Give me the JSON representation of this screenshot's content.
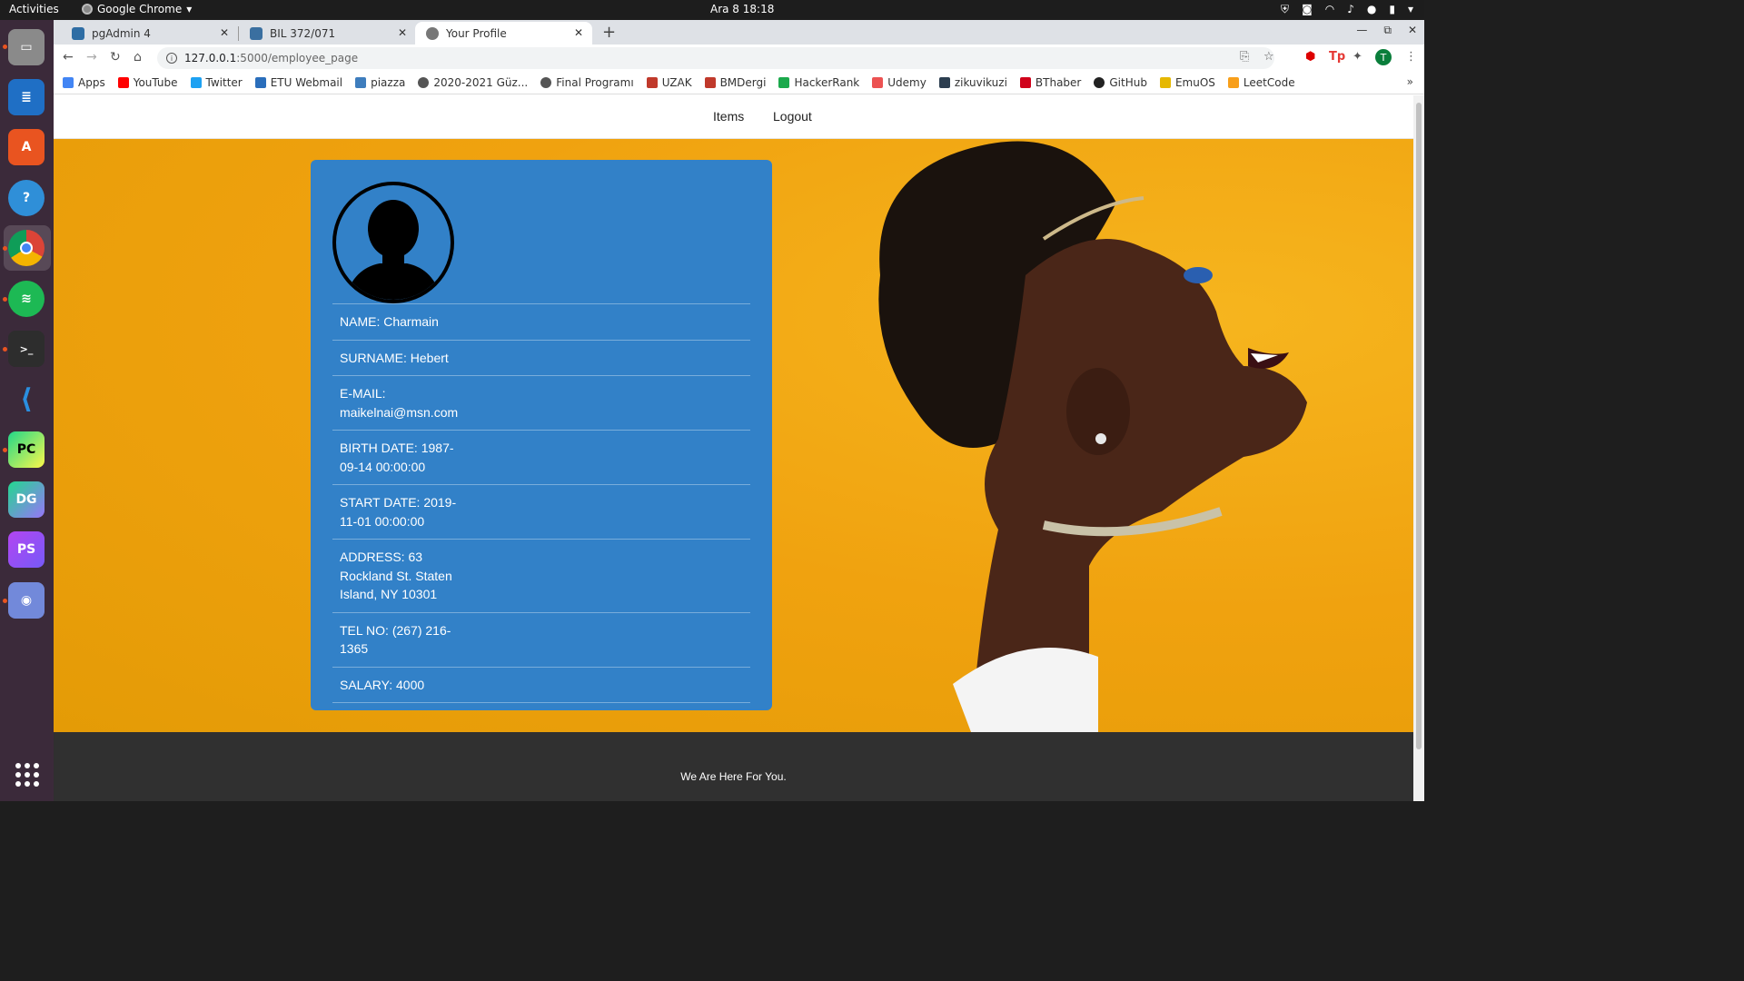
{
  "os": {
    "activities": "Activities",
    "app_name": "Google Chrome",
    "clock": "Ara 8  18:18"
  },
  "browser": {
    "tabs": [
      {
        "label": "pgAdmin 4",
        "active": false,
        "favicon_color": "#2e6da4"
      },
      {
        "label": "BIL 372/071",
        "active": false,
        "favicon_color": "#3a6fa0"
      },
      {
        "label": "Your Profile",
        "active": true,
        "favicon_color": "#777777"
      }
    ],
    "url_host": "127.0.0.1",
    "url_path": ":5000/employee_page",
    "profile_initial": "T",
    "bookmarks": [
      {
        "label": "Apps",
        "icon": "apps-grid-icon",
        "color": "#4285f4"
      },
      {
        "label": "YouTube",
        "icon": "youtube-icon",
        "color": "#ff0000"
      },
      {
        "label": "Twitter",
        "icon": "twitter-icon",
        "color": "#1da1f2"
      },
      {
        "label": "ETU Webmail",
        "icon": "webmail-icon",
        "color": "#2a6ebb"
      },
      {
        "label": "piazza",
        "icon": "piazza-icon",
        "color": "#3e7dbd"
      },
      {
        "label": "2020-2021 Güz...",
        "icon": "globe-icon",
        "color": "#555555"
      },
      {
        "label": "Final Programı",
        "icon": "globe-icon",
        "color": "#555555"
      },
      {
        "label": "UZAK",
        "icon": "uzak-icon",
        "color": "#c0392b"
      },
      {
        "label": "BMDergi",
        "icon": "bmdergi-icon",
        "color": "#c0392b"
      },
      {
        "label": "HackerRank",
        "icon": "hackerrank-icon",
        "color": "#1ba94c"
      },
      {
        "label": "Udemy",
        "icon": "udemy-icon",
        "color": "#ec5252"
      },
      {
        "label": "zikuvikuzi",
        "icon": "zikuvikuzi-icon",
        "color": "#2c3e50"
      },
      {
        "label": "BThaber",
        "icon": "bthaber-icon",
        "color": "#d0021b"
      },
      {
        "label": "GitHub",
        "icon": "github-icon",
        "color": "#222222"
      },
      {
        "label": "EmuOS",
        "icon": "emuos-icon",
        "color": "#e6b800"
      },
      {
        "label": "LeetCode",
        "icon": "leetcode-icon",
        "color": "#f89f1b"
      }
    ]
  },
  "page": {
    "nav": {
      "items_label": "Items",
      "logout_label": "Logout"
    },
    "profile": {
      "fields": [
        {
          "text": "NAME: Charmain"
        },
        {
          "text": "SURNAME: Hebert"
        },
        {
          "text": "E-MAIL: maikelnai@msn.com"
        },
        {
          "text": "BIRTH DATE: 1987-09-14 00:00:00"
        },
        {
          "text": "START DATE: 2019-11-01 00:00:00"
        },
        {
          "text": "ADDRESS: 63 Rockland St. Staten Island, NY 10301"
        },
        {
          "text": "TEL NO: (267) 216-1365"
        },
        {
          "text": "SALARY: 4000"
        }
      ]
    },
    "footer_text": "We Are Here For You.",
    "colors": {
      "hero_yellow": "#f0a20f",
      "card_blue": "#3281c8",
      "footer_dark": "#303030"
    }
  }
}
